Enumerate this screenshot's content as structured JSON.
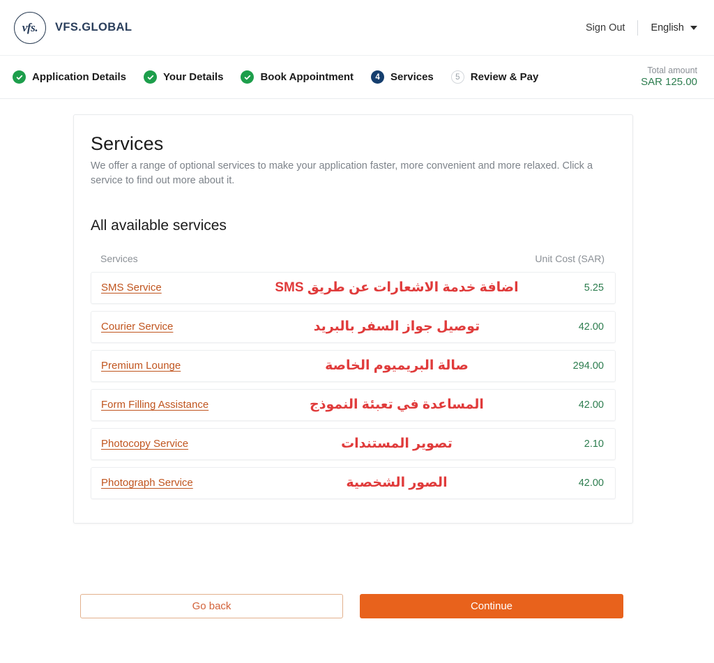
{
  "header": {
    "brand_mark": "vfs.",
    "brand_name": "VFS.GLOBAL",
    "sign_out": "Sign Out",
    "language": "English",
    "caret_icon": "chevron-down-icon"
  },
  "stepper": {
    "steps": [
      {
        "badge": "✓",
        "label": "Application Details",
        "state": "done"
      },
      {
        "badge": "✓",
        "label": "Your Details",
        "state": "done"
      },
      {
        "badge": "✓",
        "label": "Book Appointment",
        "state": "done"
      },
      {
        "badge": "4",
        "label": "Services",
        "state": "active"
      },
      {
        "badge": "5",
        "label": "Review & Pay",
        "state": "todo"
      }
    ],
    "total_label": "Total amount",
    "total_value": "SAR 125.00"
  },
  "main": {
    "title": "Services",
    "description": "We offer a range of optional services to make your application faster, more convenient and more relaxed. Click a service to find out more about it.",
    "section_title": "All available services",
    "columns": {
      "service": "Services",
      "cost": "Unit Cost (SAR)"
    },
    "services": [
      {
        "name": "SMS Service",
        "name_ar": "اضافة خدمة الاشعارات عن طريق SMS",
        "price": "5.25"
      },
      {
        "name": "Courier Service",
        "name_ar": "توصيل جواز السفر بالبريد",
        "price": "42.00"
      },
      {
        "name": "Premium Lounge",
        "name_ar": "صالة البريميوم الخاصة",
        "price": "294.00"
      },
      {
        "name": "Form Filling Assistance",
        "name_ar": "المساعدة في تعبئة النموذج",
        "price": "42.00"
      },
      {
        "name": "Photocopy Service",
        "name_ar": "تصوير المستندات",
        "price": "2.10"
      },
      {
        "name": "Photograph Service",
        "name_ar": "الصور الشخصية",
        "price": "42.00"
      }
    ]
  },
  "footer": {
    "go_back": "Go back",
    "continue": "Continue"
  },
  "colors": {
    "brand_navy": "#2b3f5c",
    "accent_orange": "#e8621c",
    "link_orange": "#c0551f",
    "arabic_red": "#e03b3b",
    "price_green": "#2d7d4f",
    "step_done_green": "#1d9e4b",
    "step_active_navy": "#153e6e"
  }
}
